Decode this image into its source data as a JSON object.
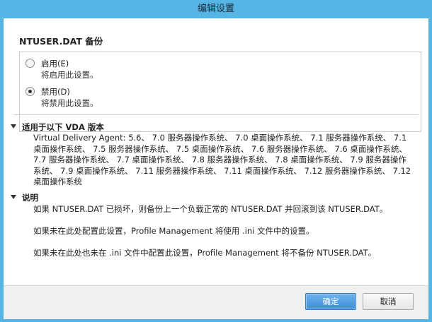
{
  "window": {
    "title": "编辑设置"
  },
  "setting": {
    "name": "NTUSER.DAT 备份"
  },
  "options": [
    {
      "label": "启用(E)",
      "description": "将启用此设置。",
      "selected": false
    },
    {
      "label": "禁用(D)",
      "description": "将禁用此设置。",
      "selected": true
    }
  ],
  "applies_to": {
    "title": "适用于以下 VDA 版本",
    "text": "Virtual Delivery Agent: 5.6、 7.0 服务器操作系统、 7.0 桌面操作系统、 7.1 服务器操作系统、 7.1 桌面操作系统、 7.5 服务器操作系统、 7.5 桌面操作系统、 7.6 服务器操作系统、 7.6 桌面操作系统、 7.7 服务器操作系统、 7.7 桌面操作系统、 7.8 服务器操作系统、 7.8 桌面操作系统、 7.9 服务器操作系统、 7.9 桌面操作系统、 7.11 服务器操作系统、 7.11 桌面操作系统、 7.12 服务器操作系统、 7.12 桌面操作系统"
  },
  "explanation": {
    "title": "说明",
    "paragraphs": [
      "如果 NTUSER.DAT 已损坏，则备份上一个负载正常的 NTUSER.DAT 并回滚到该 NTUSER.DAT。",
      "如果未在此处配置此设置，Profile Management 将使用 .ini 文件中的设置。",
      "如果未在此处也未在 .ini 文件中配置此设置，Profile Management 将不备份 NTUSER.DAT。"
    ]
  },
  "buttons": {
    "ok": "确定",
    "cancel": "取消"
  }
}
